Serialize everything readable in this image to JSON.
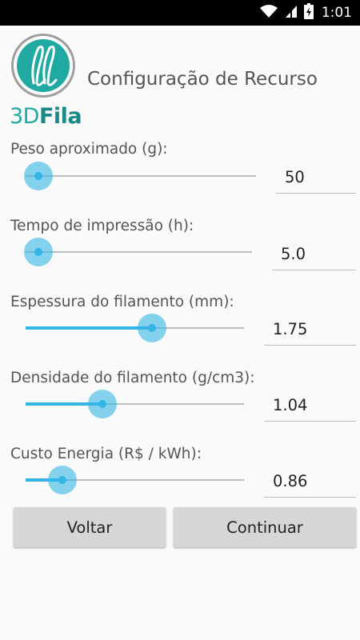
{
  "status_bar": {
    "time": "1:01"
  },
  "header": {
    "logo_text_part1": "3D",
    "logo_text_part2": "Fila",
    "title": "Configuração de Recurso"
  },
  "settings": [
    {
      "label": "Peso aproximado (g):",
      "value": "50",
      "slider_fraction": 0.0
    },
    {
      "label": "Tempo de impressão (h):",
      "value": "5.0",
      "slider_fraction": 0.0
    },
    {
      "label": "Espessura do filamento (mm):",
      "value": "1.75",
      "slider_fraction": 0.58
    },
    {
      "label": "Densidade do filamento (g/cm3):",
      "value": "1.04",
      "slider_fraction": 0.35
    },
    {
      "label": "Custo Energia (R$ / kWh):",
      "value": "0.86",
      "slider_fraction": 0.17
    }
  ],
  "buttons": {
    "back": "Voltar",
    "continue": "Continuar"
  },
  "colors": {
    "accent": "#33b5e5",
    "logo_teal": "#20a9a0",
    "button_bg": "#d6d6d6"
  }
}
